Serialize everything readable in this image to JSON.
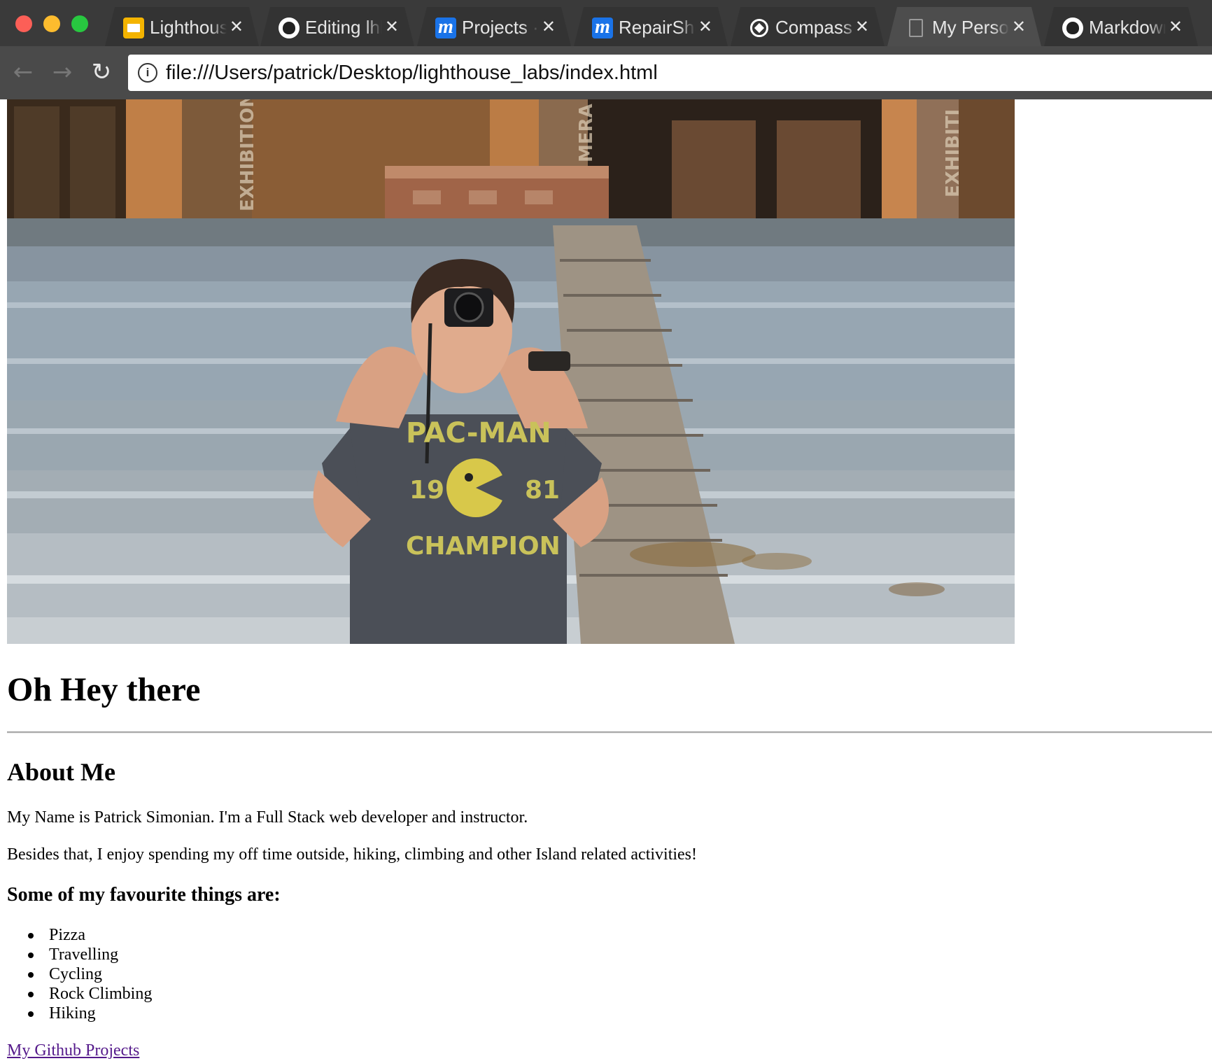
{
  "browser": {
    "tabs": [
      {
        "title": "Lighthouse",
        "icon": "slides-icon"
      },
      {
        "title": "Editing lhl",
        "icon": "github-icon"
      },
      {
        "title": "Projects · I",
        "icon": "moqups-icon"
      },
      {
        "title": "RepairShop",
        "icon": "moqups-icon"
      },
      {
        "title": "Compass",
        "icon": "compass-icon"
      },
      {
        "title": "My Persona",
        "icon": "document-icon",
        "active": true
      },
      {
        "title": "Markdown",
        "icon": "github-icon"
      }
    ],
    "url": "file:///Users/patrick/Desktop/lighthouse_labs/index.html"
  },
  "page": {
    "heading": "Oh Hey there",
    "about_heading": "About Me",
    "bio": [
      "My Name is Patrick Simonian. I'm a Full Stack web developer and instructor.",
      "Besides that, I enjoy spending my off time outside, hiking, climbing and other Island related activities!"
    ],
    "favourites_heading": "Some of my favourite things are:",
    "favourites": [
      "Pizza",
      "Travelling",
      "Cycling",
      "Rock Climbing",
      "Hiking"
    ],
    "link": "My Github Projects"
  },
  "photo": {
    "signs": [
      "EXHIBITION",
      "MERA",
      "EXHIBITI"
    ],
    "shirt_text": [
      "PAC-MAN",
      "19",
      "81",
      "CHAMPION"
    ]
  },
  "colors": {
    "tabbar": "#3a3a3a",
    "toolbar": "#4a4a4a",
    "visited_link": "#551a8b"
  }
}
